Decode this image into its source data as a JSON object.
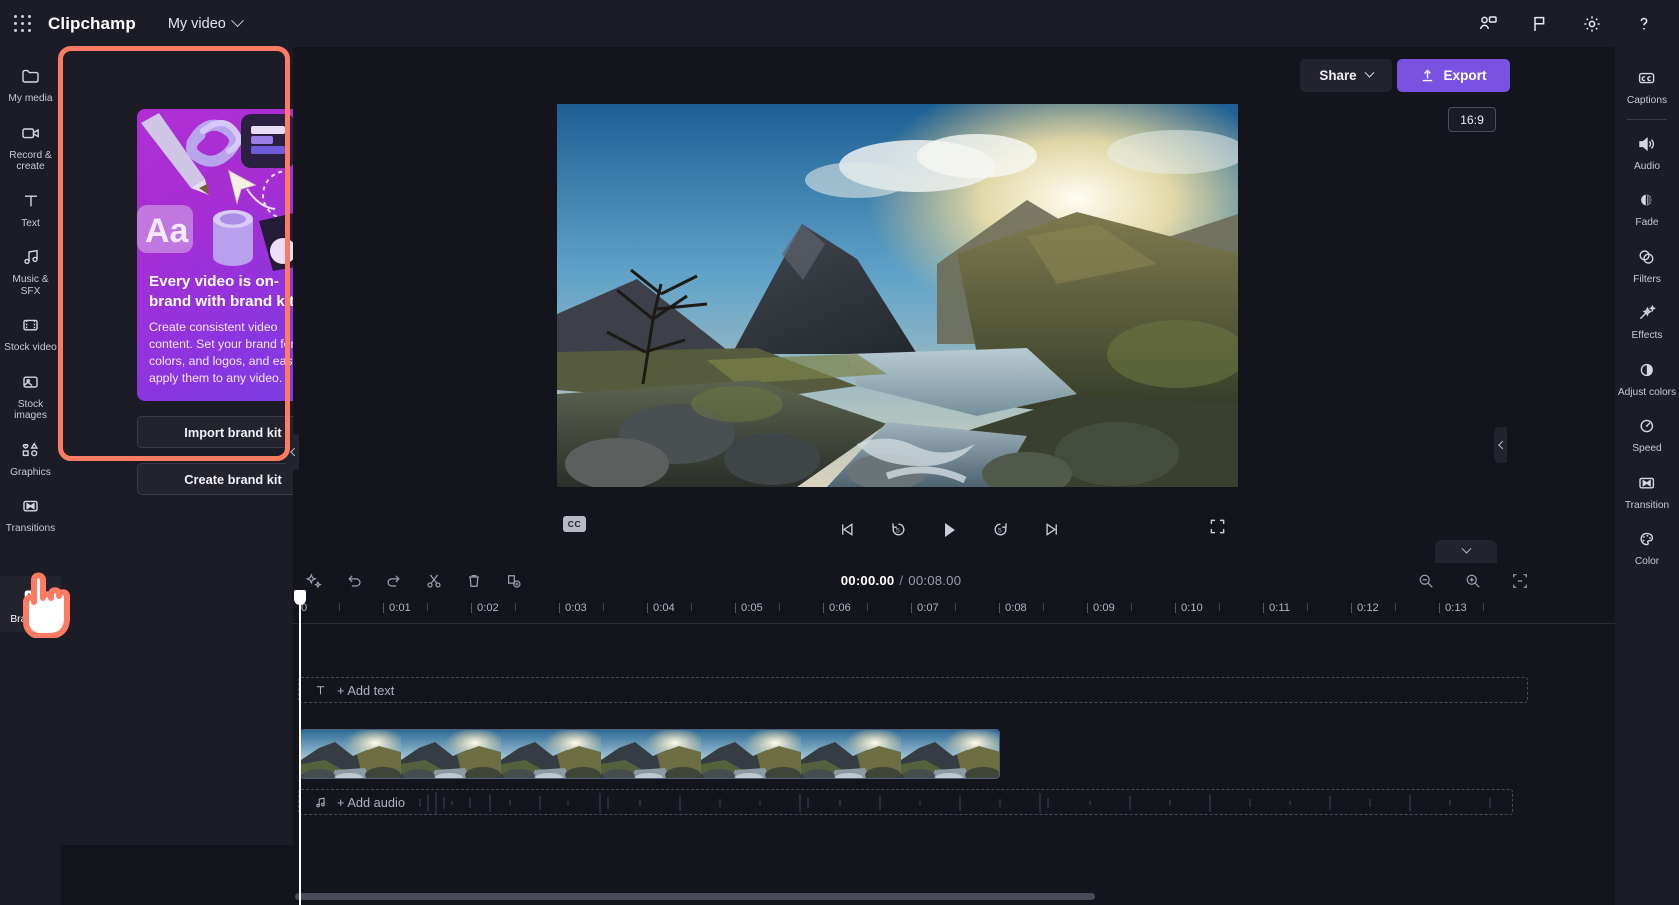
{
  "app": {
    "name": "Clipchamp",
    "project_title": "My video",
    "waffle_icon": "app-launcher-icon"
  },
  "topbar": {
    "icons": [
      {
        "name": "collaborate-icon",
        "glyph": "person-callout"
      },
      {
        "name": "flag-icon",
        "glyph": "flag"
      },
      {
        "name": "settings-icon",
        "glyph": "gear"
      },
      {
        "name": "help-icon",
        "glyph": "question-mark"
      }
    ]
  },
  "left_rail": {
    "items": [
      {
        "label": "My media",
        "icon": "folder-icon",
        "active": false
      },
      {
        "label": "Record & create",
        "icon": "video-camera-icon",
        "active": false
      },
      {
        "label": "Text",
        "icon": "text-icon",
        "active": false
      },
      {
        "label": "Music & SFX",
        "icon": "music-note-icon",
        "active": false
      },
      {
        "label": "Stock video",
        "icon": "film-strip-icon",
        "active": false
      },
      {
        "label": "Stock images",
        "icon": "image-icon",
        "active": false
      },
      {
        "label": "Graphics",
        "icon": "shapes-icon",
        "active": false
      },
      {
        "label": "Transitions",
        "icon": "transition-icon",
        "active": false
      },
      {
        "label": "Brand kit",
        "icon": "brand-tag-icon",
        "active": true
      }
    ]
  },
  "panel": {
    "promo": {
      "heading": "Every video is on-brand with brand kit",
      "body": "Create consistent video content. Set your brand fonts, colors, and logos, and easily apply them to any video.",
      "art_label": "Aa"
    },
    "import_label": "Import brand kit",
    "create_label": "Create brand kit"
  },
  "stage": {
    "share_label": "Share",
    "export_label": "Export",
    "aspect_ratio": "16:9",
    "cc_label": "CC",
    "transport": [
      {
        "name": "skip-to-start-button",
        "glyph": "skip-back"
      },
      {
        "name": "rewind-5s-button",
        "glyph": "back-5"
      },
      {
        "name": "play-button",
        "glyph": "play"
      },
      {
        "name": "forward-5s-button",
        "glyph": "forward-5"
      },
      {
        "name": "skip-to-end-button",
        "glyph": "skip-forward"
      }
    ],
    "fullscreen_icon": "fullscreen-icon"
  },
  "timeline": {
    "tools": [
      {
        "name": "magic-tools-button",
        "glyph": "sparkles"
      },
      {
        "name": "undo-button",
        "glyph": "undo"
      },
      {
        "name": "redo-button",
        "glyph": "redo"
      },
      {
        "name": "split-button",
        "glyph": "scissors"
      },
      {
        "name": "delete-button",
        "glyph": "trash"
      },
      {
        "name": "duplicate-button",
        "glyph": "duplicate"
      }
    ],
    "current_time": "00:00.00",
    "separator": "/",
    "total_time": "00:08.00",
    "zoom_tools": [
      {
        "name": "zoom-out-button",
        "glyph": "zoom-out"
      },
      {
        "name": "zoom-in-button",
        "glyph": "zoom-in"
      },
      {
        "name": "fit-to-timeline-button",
        "glyph": "fit"
      }
    ],
    "ruler_ticks": [
      "0",
      "0:01",
      "0:02",
      "0:03",
      "0:04",
      "0:05",
      "0:06",
      "0:07",
      "0:08",
      "0:09",
      "0:10",
      "0:11",
      "0:12",
      "0:13"
    ],
    "add_text_label": "+ Add text",
    "add_audio_label": "+ Add audio"
  },
  "right_rail": {
    "items": [
      {
        "label": "Captions",
        "icon": "closed-captions-icon"
      },
      {
        "label": "Audio",
        "icon": "speaker-icon"
      },
      {
        "label": "Fade",
        "icon": "fade-icon"
      },
      {
        "label": "Filters",
        "icon": "filters-icon"
      },
      {
        "label": "Effects",
        "icon": "magic-wand-icon"
      },
      {
        "label": "Adjust colors",
        "icon": "contrast-icon"
      },
      {
        "label": "Speed",
        "icon": "speedometer-icon"
      },
      {
        "label": "Transition",
        "icon": "transition-icon"
      },
      {
        "label": "Color",
        "icon": "palette-icon"
      }
    ]
  },
  "colors": {
    "accent": "#7a52e1",
    "highlight": "#fd7b63",
    "chrome": "#1c1c26",
    "canvas": "#14141c"
  }
}
